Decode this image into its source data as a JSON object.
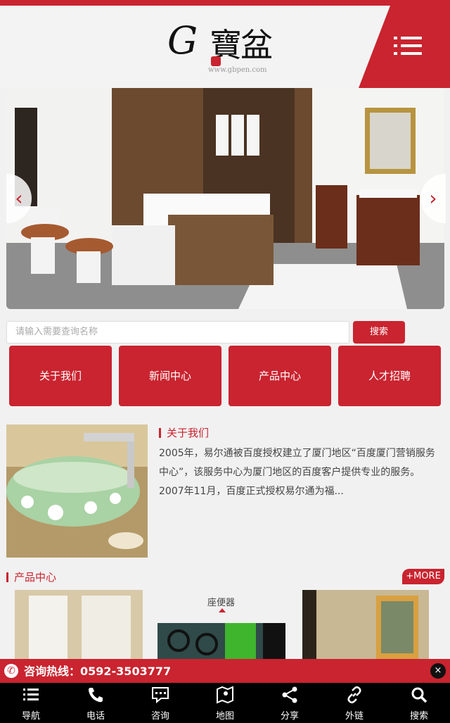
{
  "header": {
    "logo_letter": "G",
    "logo_text": "寶盆",
    "logo_url": "www.gbpen.com",
    "menu_icon": "hamburger-icon"
  },
  "search": {
    "placeholder": "请输入需要查询名称",
    "button": "搜索"
  },
  "nav_buttons": [
    "关于我们",
    "新闻中心",
    "产品中心",
    "人才招聘"
  ],
  "about": {
    "title": "关于我们",
    "text": "2005年，易尔通被百度授权建立了厦门地区“百度厦门营销服务中心”，该服务中心为厦门地区的百度客户提供专业的服务。2007年11月，百度正式授权易尔通为福..."
  },
  "products": {
    "title": "产品中心",
    "more": "+MORE",
    "item_label": "座便器"
  },
  "hotline": {
    "text": "咨询热线：0592-3503777",
    "close": "×"
  },
  "bottom_nav": [
    {
      "label": "导航",
      "icon": "list-icon"
    },
    {
      "label": "电话",
      "icon": "phone-icon"
    },
    {
      "label": "咨询",
      "icon": "chat-icon"
    },
    {
      "label": "地图",
      "icon": "map-icon"
    },
    {
      "label": "分享",
      "icon": "share-icon"
    },
    {
      "label": "外链",
      "icon": "link-icon"
    },
    {
      "label": "搜索",
      "icon": "search-icon"
    }
  ],
  "colors": {
    "brand_red": "#c9242f",
    "background": "#f1f1f1"
  }
}
